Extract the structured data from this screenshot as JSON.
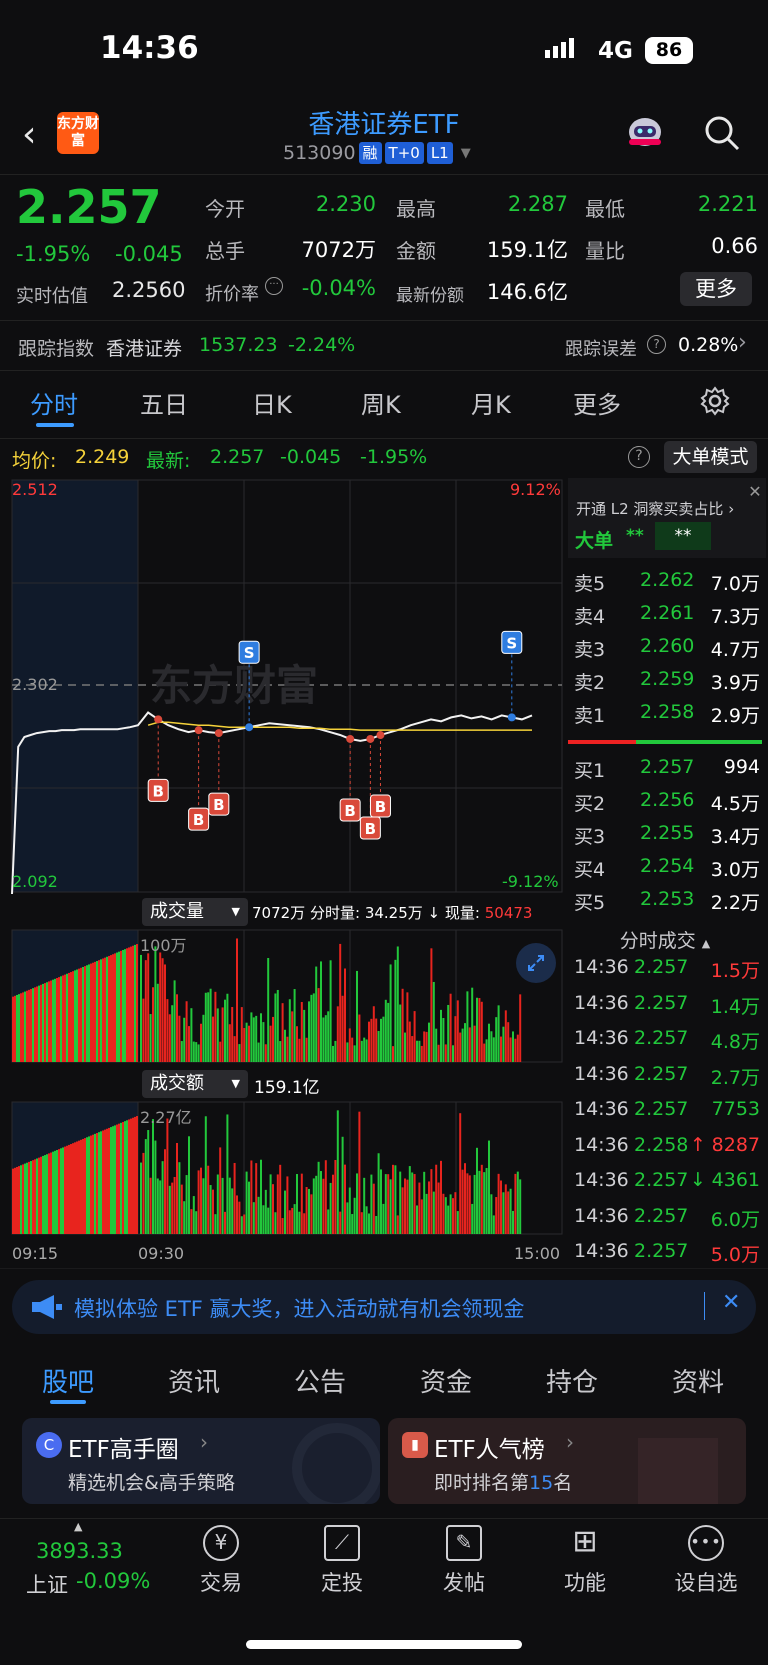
{
  "status_bar": {
    "time": "14:36",
    "network": "4G",
    "battery": "86"
  },
  "header": {
    "logo_text": "东方财富",
    "title": "香港证券ETF",
    "code": "513090",
    "badges": [
      "融",
      "T+0",
      "L1"
    ]
  },
  "quote": {
    "price": "2.257",
    "change_pct": "-1.95%",
    "change": "-0.045",
    "est_label": "实时估值",
    "est_value": "2.2560",
    "open_label": "今开",
    "open": "2.230",
    "high_label": "最高",
    "high": "2.287",
    "low_label": "最低",
    "low": "2.221",
    "vol_label": "总手",
    "vol": "7072万",
    "amount_label": "金额",
    "amount": "159.1亿",
    "ratio_label": "量比",
    "ratio": "0.66",
    "discount_label": "折价率",
    "discount": "-0.04%",
    "shares_label": "最新份额",
    "shares": "146.6亿",
    "more_button": "更多",
    "track_label": "跟踪指数",
    "track_name": "香港证券",
    "track_value": "1537.23",
    "track_change": "-2.24%",
    "err_label": "跟踪误差",
    "err_value": "0.28%"
  },
  "tabs": [
    "分时",
    "五日",
    "日K",
    "周K",
    "月K",
    "更多"
  ],
  "chart_info": {
    "avg_label": "均价:",
    "avg": "2.249",
    "latest_label": "最新:",
    "latest": "2.257",
    "latest_chg": "-0.045",
    "latest_pct": "-1.95%",
    "mode_button": "大单模式"
  },
  "chart_data": {
    "type": "line",
    "ylim": [
      2.092,
      2.512
    ],
    "y_labels": {
      "top": "2.512",
      "mid": "2.302",
      "bottom": "2.092",
      "top_pct": "9.12%",
      "bottom_pct": "-9.12%"
    },
    "x_labels": [
      "09:15",
      "09:30",
      "15:00"
    ],
    "watermark": "东方财富",
    "price_series": [
      2.09,
      2.24,
      2.25,
      2.252,
      2.254,
      2.255,
      2.256,
      2.256,
      2.257,
      2.257,
      2.257,
      2.258,
      2.258,
      2.258,
      2.258,
      2.258,
      2.258,
      2.258,
      2.259,
      2.26,
      2.262,
      2.275,
      2.268,
      2.262,
      2.258,
      2.255,
      2.257,
      2.255,
      2.254,
      2.256,
      2.258,
      2.26,
      2.262,
      2.264,
      2.263,
      2.262,
      2.261,
      2.26,
      2.258,
      2.255,
      2.252,
      2.248,
      2.246,
      2.248,
      2.252,
      2.255,
      2.258,
      2.262,
      2.265,
      2.268,
      2.266,
      2.27,
      2.272,
      2.269,
      2.271,
      2.268,
      2.272,
      2.27,
      2.268,
      2.272
    ],
    "avg_series": [
      null,
      null,
      null,
      null,
      null,
      null,
      null,
      null,
      null,
      null,
      null,
      null,
      null,
      null,
      null,
      null,
      null,
      null,
      null,
      null,
      null,
      2.262,
      2.265,
      2.265,
      2.264,
      2.263,
      2.262,
      2.262,
      2.261,
      2.26,
      2.26,
      2.26,
      2.26,
      2.26,
      2.26,
      2.26,
      2.259,
      2.259,
      2.259,
      2.258,
      2.258,
      2.258,
      2.257,
      2.257,
      2.257,
      2.257,
      2.257,
      2.257,
      2.257,
      2.257,
      2.257,
      2.257,
      2.257,
      2.257,
      2.257,
      2.257,
      2.257,
      2.257,
      2.257,
      2.257
    ],
    "signals": [
      {
        "t": 22,
        "type": "B"
      },
      {
        "t": 26,
        "type": "B"
      },
      {
        "t": 28,
        "type": "B"
      },
      {
        "t": 31,
        "type": "S"
      },
      {
        "t": 41,
        "type": "B"
      },
      {
        "t": 43,
        "type": "B"
      },
      {
        "t": 44,
        "type": "B"
      },
      {
        "t": 57,
        "type": "S"
      }
    ],
    "volume_label": "成交量",
    "volume_summary": "7072万",
    "volume_min_label": "分时量:",
    "volume_min": "34.25万",
    "volume_now_label": "现量:",
    "volume_now": "50473",
    "volume_scale": "100万",
    "amount_label": "成交额",
    "amount_summary": "159.1亿",
    "amount_scale": "2.27亿"
  },
  "order_book": {
    "promo": "开通 L2 洞察买卖占比",
    "big_label": "大单",
    "big_val1": "**",
    "big_val2": "**",
    "asks": [
      {
        "label": "卖5",
        "price": "2.262",
        "vol": "7.0万"
      },
      {
        "label": "卖4",
        "price": "2.261",
        "vol": "7.3万"
      },
      {
        "label": "卖3",
        "price": "2.260",
        "vol": "4.7万"
      },
      {
        "label": "卖2",
        "price": "2.259",
        "vol": "3.9万"
      },
      {
        "label": "卖1",
        "price": "2.258",
        "vol": "2.9万"
      }
    ],
    "bids": [
      {
        "label": "买1",
        "price": "2.257",
        "vol": "994"
      },
      {
        "label": "买2",
        "price": "2.256",
        "vol": "4.5万"
      },
      {
        "label": "买3",
        "price": "2.255",
        "vol": "3.4万"
      },
      {
        "label": "买4",
        "price": "2.254",
        "vol": "3.0万"
      },
      {
        "label": "买5",
        "price": "2.253",
        "vol": "2.2万"
      }
    ],
    "trades_title": "分时成交",
    "trades": [
      {
        "time": "14:36",
        "price": "2.257",
        "arrow": "",
        "vol": "1.5万",
        "side": "sell"
      },
      {
        "time": "14:36",
        "price": "2.257",
        "arrow": "",
        "vol": "1.4万",
        "side": "buy"
      },
      {
        "time": "14:36",
        "price": "2.257",
        "arrow": "",
        "vol": "4.8万",
        "side": "buy"
      },
      {
        "time": "14:36",
        "price": "2.257",
        "arrow": "",
        "vol": "2.7万",
        "side": "buy"
      },
      {
        "time": "14:36",
        "price": "2.257",
        "arrow": "",
        "vol": "7753",
        "side": "buy"
      },
      {
        "time": "14:36",
        "price": "2.258",
        "arrow": "↑",
        "vol": "8287",
        "side": "sell"
      },
      {
        "time": "14:36",
        "price": "2.257",
        "arrow": "↓",
        "vol": "4361",
        "side": "buy"
      },
      {
        "time": "14:36",
        "price": "2.257",
        "arrow": "",
        "vol": "6.0万",
        "side": "buy"
      },
      {
        "time": "14:36",
        "price": "2.257",
        "arrow": "",
        "vol": "5.0万",
        "side": "sell"
      }
    ]
  },
  "banner": {
    "text": "模拟体验 ETF 赢大奖，进入活动就有机会领现金"
  },
  "bottom_tabs": [
    "股吧",
    "资讯",
    "公告",
    "资金",
    "持仓",
    "资料"
  ],
  "cards": [
    {
      "title": "ETF高手圈",
      "sub": "精选机会&高手策略"
    },
    {
      "title": "ETF人气榜",
      "sub_prefix": "即时排名第",
      "rank": "15",
      "sub_suffix": "名"
    }
  ],
  "bottom_nav": {
    "index_value": "3893.33",
    "index_name": "上证",
    "index_change": "-0.09%",
    "items": [
      {
        "label": "交易",
        "icon": "yen"
      },
      {
        "label": "定投",
        "icon": "chart"
      },
      {
        "label": "发帖",
        "icon": "edit"
      },
      {
        "label": "功能",
        "icon": "grid"
      },
      {
        "label": "设自选",
        "icon": "more"
      }
    ]
  }
}
